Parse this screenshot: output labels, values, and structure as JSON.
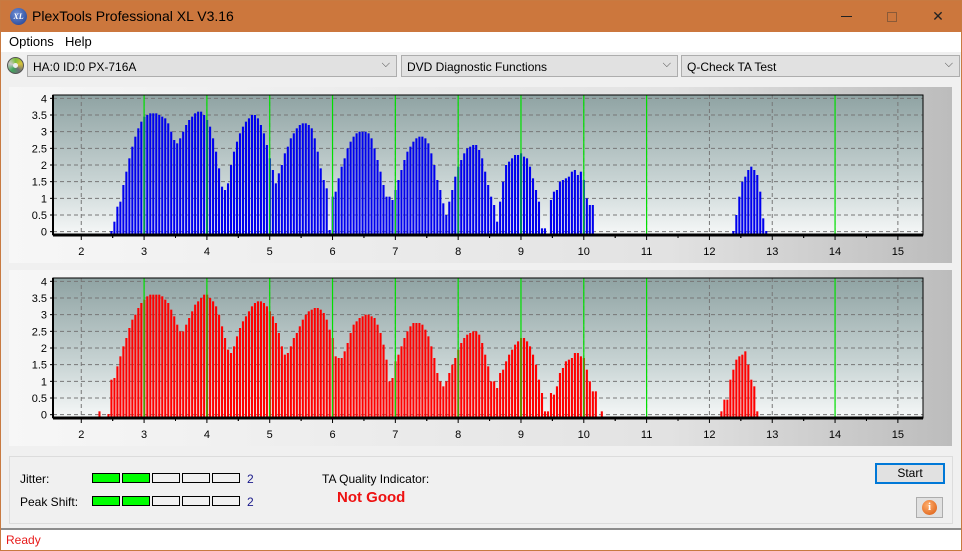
{
  "window": {
    "title": "PlexTools Professional XL V3.16",
    "icon": "xl-logo-icon",
    "controls": {
      "minimize": "—",
      "maximize": "□",
      "close": "✕"
    }
  },
  "menu": {
    "items": [
      {
        "label": "Options"
      },
      {
        "label": "Help"
      }
    ]
  },
  "toolbar": {
    "drive": {
      "value": "HA:0 ID:0  PX-716A"
    },
    "function": {
      "value": "DVD Diagnostic Functions"
    },
    "test": {
      "value": "Q-Check TA Test"
    },
    "chevron": "⌵"
  },
  "chart_data": [
    {
      "type": "bar",
      "name": "ta-land-chart",
      "color": "#0000ee",
      "xlim": [
        1.55,
        15.4
      ],
      "ylim": [
        -0.1,
        4.1
      ],
      "x_ticks": [
        "2",
        "3",
        "4",
        "5",
        "6",
        "7",
        "8",
        "9",
        "10",
        "11",
        "12",
        "13",
        "14",
        "15"
      ],
      "y_ticks": [
        "0",
        "0.5",
        "1",
        "1.5",
        "2",
        "2.5",
        "3",
        "3.5",
        "4"
      ],
      "green_markers": [
        3,
        4,
        5,
        6,
        7,
        8,
        9,
        10,
        11,
        14
      ],
      "grid": true,
      "x_start": 2.48,
      "step": 0.0476,
      "values": [
        0.02,
        0.3,
        0.75,
        0.9,
        1.4,
        1.8,
        2.2,
        2.55,
        2.85,
        3.1,
        3.3,
        3.45,
        3.5,
        3.55,
        3.55,
        3.55,
        3.5,
        3.45,
        3.4,
        3.25,
        3.0,
        2.75,
        2.65,
        2.8,
        3.0,
        3.2,
        3.35,
        3.45,
        3.55,
        3.6,
        3.6,
        3.5,
        3.35,
        3.15,
        2.8,
        2.4,
        1.9,
        1.35,
        1.25,
        1.45,
        2.0,
        2.4,
        2.7,
        2.95,
        3.15,
        3.3,
        3.4,
        3.5,
        3.5,
        3.4,
        3.2,
        2.95,
        2.6,
        2.2,
        1.85,
        1.45,
        1.75,
        2.0,
        2.35,
        2.55,
        2.8,
        2.95,
        3.1,
        3.2,
        3.25,
        3.25,
        3.2,
        3.1,
        2.8,
        2.4,
        1.9,
        1.55,
        1.3,
        0.05,
        1.05,
        1.2,
        1.6,
        1.95,
        2.2,
        2.5,
        2.7,
        2.85,
        2.95,
        3.0,
        3.0,
        3.0,
        2.95,
        2.8,
        2.5,
        2.15,
        1.8,
        1.4,
        1.05,
        1.05,
        0.95,
        1.25,
        1.55,
        1.85,
        2.15,
        2.4,
        2.55,
        2.7,
        2.8,
        2.85,
        2.85,
        2.8,
        2.65,
        2.35,
        2.0,
        1.55,
        1.25,
        0.85,
        0.5,
        0.9,
        1.25,
        1.65,
        1.95,
        2.15,
        2.35,
        2.5,
        2.55,
        2.6,
        2.6,
        2.45,
        2.2,
        1.8,
        1.4,
        1.05,
        0.8,
        0.3,
        0.9,
        1.5,
        2.0,
        2.1,
        2.2,
        2.3,
        2.3,
        2.35,
        2.25,
        2.2,
        1.95,
        1.6,
        1.25,
        0.9,
        0.1,
        0.1,
        null,
        0.95,
        1.2,
        1.25,
        1.5,
        1.55,
        1.6,
        1.65,
        1.8,
        1.85,
        1.7,
        1.8,
        1.55,
        1.0,
        0.8,
        0.8,
        null,
        null,
        null,
        null,
        null,
        null,
        null,
        null,
        null,
        null,
        null,
        null,
        null,
        null,
        null,
        null,
        null,
        null,
        null,
        null,
        null,
        null,
        null,
        null,
        null,
        null,
        null,
        null,
        null,
        null,
        null,
        null,
        null,
        null,
        null,
        null,
        null,
        null,
        null,
        null,
        null,
        null,
        null,
        null,
        null,
        null,
        0.02,
        0.5,
        1.05,
        1.5,
        1.65,
        1.85,
        1.95,
        1.85,
        1.7,
        1.2,
        0.4,
        0.02
      ]
    },
    {
      "type": "bar",
      "name": "ta-pit-chart",
      "color": "#ff0000",
      "xlim": [
        1.55,
        15.4
      ],
      "ylim": [
        -0.1,
        4.1
      ],
      "x_ticks": [
        "2",
        "3",
        "4",
        "5",
        "6",
        "7",
        "8",
        "9",
        "10",
        "11",
        "12",
        "13",
        "14",
        "15"
      ],
      "y_ticks": [
        "0",
        "0.5",
        "1",
        "1.5",
        "2",
        "2.5",
        "3",
        "3.5",
        "4"
      ],
      "green_markers": [
        3,
        4,
        5,
        6,
        7,
        8,
        9,
        10,
        11,
        14
      ],
      "grid": true,
      "x_start": 2.29,
      "step": 0.0476,
      "values": [
        0.1,
        null,
        null,
        0.02,
        1.05,
        1.1,
        1.45,
        1.75,
        2.05,
        2.3,
        2.6,
        2.85,
        3.0,
        3.2,
        3.35,
        3.45,
        3.55,
        3.6,
        3.6,
        3.6,
        3.6,
        3.55,
        3.45,
        3.35,
        3.15,
        2.95,
        2.7,
        2.5,
        2.5,
        2.7,
        2.9,
        3.1,
        3.3,
        3.4,
        3.5,
        3.6,
        3.6,
        3.5,
        3.4,
        3.25,
        3.0,
        2.65,
        2.3,
        1.95,
        1.85,
        2.05,
        2.35,
        2.6,
        2.8,
        2.95,
        3.1,
        3.25,
        3.35,
        3.4,
        3.4,
        3.35,
        3.25,
        3.1,
        2.95,
        2.75,
        2.45,
        2.05,
        1.8,
        1.85,
        2.05,
        2.3,
        2.45,
        2.65,
        2.85,
        3.0,
        3.1,
        3.15,
        3.2,
        3.2,
        3.15,
        3.05,
        2.85,
        2.55,
        2.3,
        1.75,
        1.7,
        1.7,
        1.9,
        2.15,
        2.45,
        2.7,
        2.8,
        2.9,
        2.95,
        3.0,
        3.0,
        2.95,
        2.9,
        2.7,
        2.45,
        2.1,
        1.65,
        1.0,
        1.1,
        1.6,
        1.8,
        2.05,
        2.3,
        2.5,
        2.65,
        2.75,
        2.75,
        2.75,
        2.7,
        2.55,
        2.35,
        2.05,
        1.7,
        1.25,
        1.0,
        0.85,
        1.0,
        1.25,
        1.5,
        1.7,
        1.95,
        2.15,
        2.3,
        2.4,
        2.45,
        2.5,
        2.5,
        2.4,
        2.15,
        1.8,
        1.45,
        1.0,
        1.0,
        0.8,
        1.25,
        1.35,
        1.6,
        1.8,
        1.95,
        2.1,
        2.2,
        2.3,
        2.3,
        2.2,
        2.05,
        1.8,
        1.5,
        1.05,
        0.65,
        0.1,
        0.1,
        0.65,
        0.6,
        0.85,
        1.25,
        1.4,
        1.6,
        1.65,
        1.7,
        1.85,
        1.85,
        1.75,
        1.7,
        1.35,
        1.0,
        0.7,
        0.7,
        null,
        0.1,
        null,
        null,
        null,
        null,
        null,
        null,
        null,
        null,
        null,
        null,
        null,
        null,
        null,
        null,
        null,
        null,
        null,
        null,
        null,
        null,
        null,
        null,
        null,
        null,
        null,
        null,
        null,
        null,
        null,
        null,
        null,
        null,
        null,
        null,
        null,
        null,
        null,
        null,
        null,
        0.1,
        0.45,
        0.45,
        1.05,
        1.35,
        1.65,
        1.75,
        1.8,
        1.9,
        1.5,
        1.05,
        0.85,
        0.1
      ]
    }
  ],
  "metrics": {
    "jitter": {
      "label": "Jitter:",
      "level": 2,
      "max": 5,
      "value": "2"
    },
    "peak_shift": {
      "label": "Peak Shift:",
      "level": 2,
      "max": 5,
      "value": "2"
    },
    "ta_quality": {
      "label": "TA Quality Indicator:",
      "value": "Not Good"
    }
  },
  "buttons": {
    "start": "Start",
    "info": "i"
  },
  "status": {
    "text": "Ready"
  }
}
